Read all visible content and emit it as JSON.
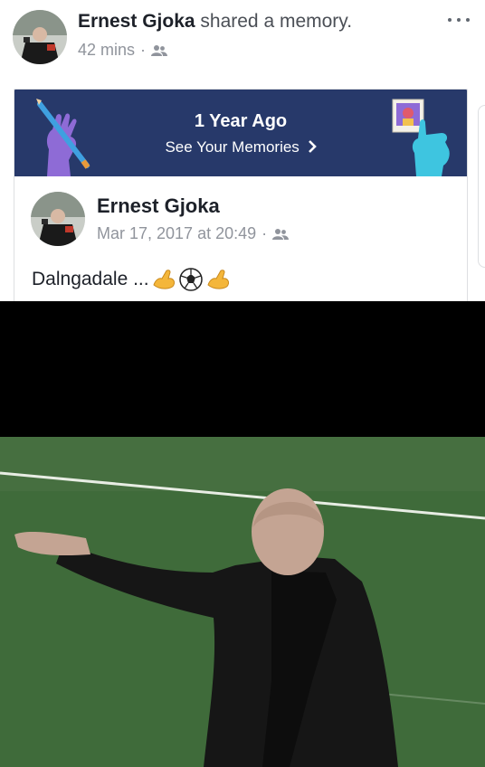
{
  "header": {
    "author": "Ernest Gjoka",
    "action": "shared a memory.",
    "time": "42 mins",
    "separator": "·",
    "audience_icon": "friends-icon",
    "more_icon": "more-options-icon"
  },
  "memory_banner": {
    "title": "1 Year Ago",
    "link": "See Your Memories",
    "link_icon": "chevron-right-icon"
  },
  "original_post": {
    "author": "Ernest Gjoka",
    "timestamp": "Mar 17, 2017 at 20:49",
    "separator": "·",
    "audience_icon": "friends-icon",
    "text": "Dalngadale ...",
    "emojis": [
      "flexed-biceps-emoji",
      "soccer-ball-emoji",
      "flexed-biceps-emoji"
    ]
  },
  "colors": {
    "banner_bg": "#27396a",
    "text_primary": "#1d2129",
    "text_secondary": "#90949c",
    "pitch_green": "#3f6b3a"
  }
}
